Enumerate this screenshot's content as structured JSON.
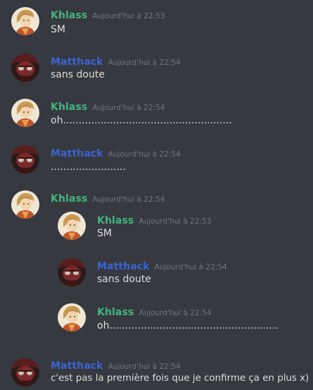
{
  "colors": {
    "background": "#36393f",
    "khlass": "#43b581",
    "matthack": "#3b63d4",
    "timestamp": "#72767d",
    "text": "#dcddde"
  },
  "messages": [
    {
      "author": "Khlass",
      "timestamp": "Aujourd'hui à 22:53",
      "text": "SM",
      "avatar": "khlass-avatar-icon"
    },
    {
      "author": "Matthack",
      "timestamp": "Aujourd'hui à 22:54",
      "text": "sans doute",
      "avatar": "matthack-avatar-icon"
    },
    {
      "author": "Khlass",
      "timestamp": "Aujourd'hui à 22:54",
      "text": "oh......................................................",
      "avatar": "khlass-avatar-icon"
    },
    {
      "author": "Matthack",
      "timestamp": "Aujourd'hui à 22:54",
      "text": "........................",
      "avatar": "matthack-avatar-icon"
    },
    {
      "author": "Khlass",
      "timestamp": "Aujourd'hui à 22:54",
      "avatar": "khlass-avatar-icon",
      "quoted": [
        {
          "author": "Khlass",
          "timestamp": "Aujourd'hui à 22:53",
          "text": "SM"
        },
        {
          "author": "Matthack",
          "timestamp": "Aujourd'hui à 22:54",
          "text": "sans doute"
        },
        {
          "author": "Khlass",
          "timestamp": "Aujourd'hui à 22:54",
          "text": "oh......................................................"
        }
      ]
    },
    {
      "author": "Matthack",
      "timestamp": "Aujourd'hui à 22:54",
      "text": "c'est pas la première fois que je confirme ça en plus x)",
      "avatar": "matthack-avatar-icon"
    }
  ]
}
